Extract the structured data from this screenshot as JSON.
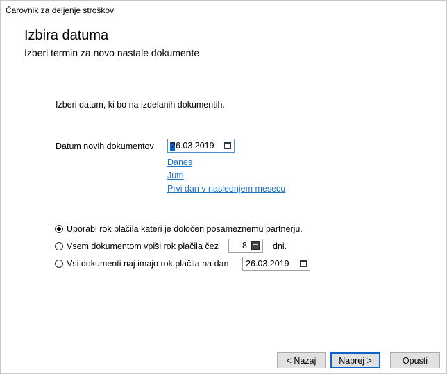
{
  "window": {
    "title": "Čarovnik za deljenje stroškov"
  },
  "header": {
    "title": "Izbira datuma",
    "subtitle": "Izberi termin za novo nastale dokumente"
  },
  "main": {
    "intro": "Izberi datum, ki bo na izdelanih dokumentih.",
    "date_label": "Datum novih dokumentov",
    "date_value": "26.03.2019",
    "links": {
      "today": "Danes",
      "tomorrow": "Jutri",
      "first_of_next_month": "Prvi dan v naslednjem mesecu"
    },
    "options": {
      "partner_terms": {
        "label": "Uporabi rok plačila kateri je določen posameznemu partnerju.",
        "checked": true
      },
      "days_terms": {
        "label": "Vsem dokumentom vpiši rok plačila čez",
        "days_value": "8",
        "suffix": "dni.",
        "checked": false
      },
      "fixed_date": {
        "label": "Vsi dokumenti naj imajo rok plačila na dan",
        "date_value": "26.03.2019",
        "checked": false
      }
    }
  },
  "footer": {
    "back_label": "< Nazaj",
    "next_label": "Naprej >",
    "cancel_label": "Opusti"
  },
  "colors": {
    "link": "#1a73c9",
    "focus": "#0a64c8"
  }
}
